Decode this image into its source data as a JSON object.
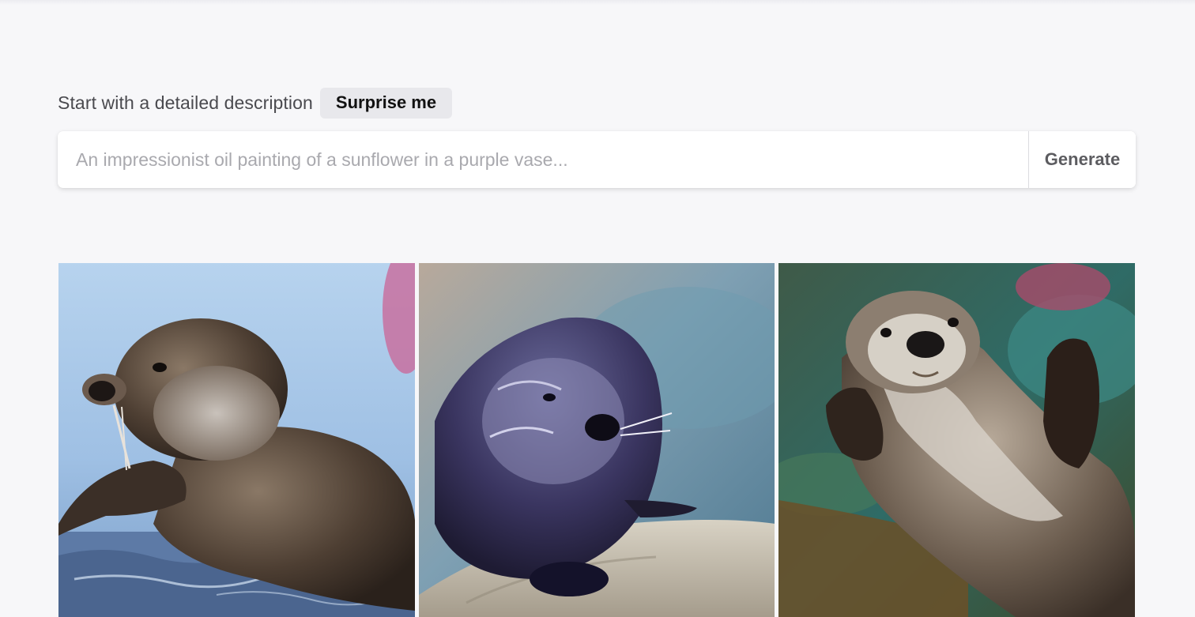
{
  "prompt": {
    "intro": "Start with a detailed description",
    "surprise_label": "Surprise me",
    "placeholder": "An impressionist oil painting of a sunflower in a purple vase...",
    "value": "",
    "generate_label": "Generate"
  },
  "gallery": {
    "images": [
      {
        "subject": "sea otter resting in water"
      },
      {
        "subject": "wet otter on a rock"
      },
      {
        "subject": "otter painting waving paw"
      }
    ]
  }
}
